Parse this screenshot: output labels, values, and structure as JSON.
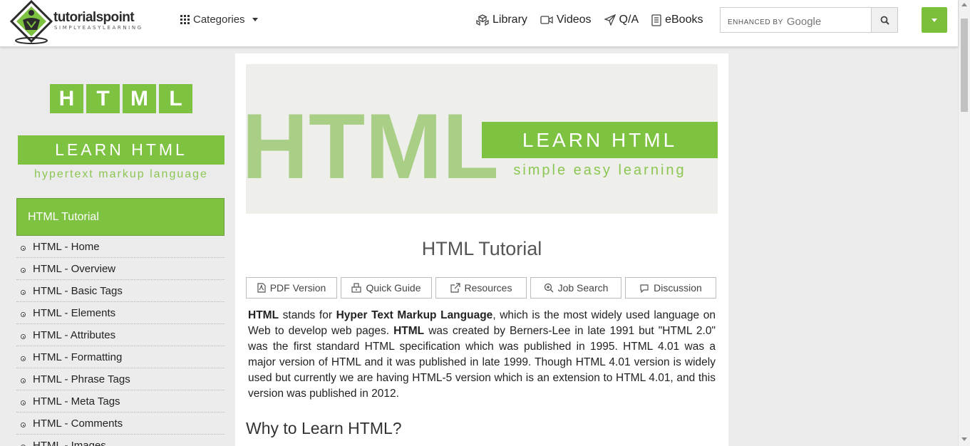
{
  "header": {
    "logo": {
      "brand": "tutorialspoint",
      "tagline": "SIMPLYEASYLEARNING"
    },
    "categories_label": "Categories",
    "nav": [
      {
        "label": "Library",
        "icon": "library-icon"
      },
      {
        "label": "Videos",
        "icon": "video-icon"
      },
      {
        "label": "Q/A",
        "icon": "send-icon"
      },
      {
        "label": "eBooks",
        "icon": "book-icon"
      }
    ],
    "search": {
      "label_prefix": "ENHANCED BY",
      "label_brand": "Google"
    },
    "colors": {
      "accent": "#7ec242"
    }
  },
  "sidebar": {
    "banner": {
      "tiles": [
        "H",
        "T",
        "M",
        "L"
      ],
      "learn": "LEARN HTML",
      "subtitle": "hypertext markup language"
    },
    "active_item": "HTML Tutorial",
    "items": [
      "HTML - Home",
      "HTML - Overview",
      "HTML - Basic Tags",
      "HTML - Elements",
      "HTML - Attributes",
      "HTML - Formatting",
      "HTML - Phrase Tags",
      "HTML - Meta Tags",
      "HTML - Comments",
      "HTML - Images"
    ]
  },
  "main": {
    "banner": {
      "big_text": "HTML",
      "learn": "LEARN HTML",
      "subtitle": "simple easy learning"
    },
    "title": "HTML Tutorial",
    "actions": [
      {
        "label": "PDF Version",
        "icon": "pdf-icon"
      },
      {
        "label": "Quick Guide",
        "icon": "quick-guide-icon"
      },
      {
        "label": "Resources",
        "icon": "external-link-icon"
      },
      {
        "label": "Job Search",
        "icon": "job-search-icon"
      },
      {
        "label": "Discussion",
        "icon": "discussion-icon"
      }
    ],
    "intro": {
      "t1": "HTML",
      "t2": " stands for ",
      "t3": "Hyper Text Markup Language",
      "t4": ", which is the most widely used language on Web to develop web pages. ",
      "t5": "HTML",
      "t6": " was created by Berners-Lee in late 1991 but \"HTML 2.0\" was the first standard HTML specification which was published in 1995. HTML 4.01 was a major version of HTML and it was published in late 1999. Though HTML 4.01 version is widely used but currently we are having HTML-5 version which is an extension to HTML 4.01, and this version was published in 2012."
    },
    "heading": "Why to Learn HTML?"
  }
}
